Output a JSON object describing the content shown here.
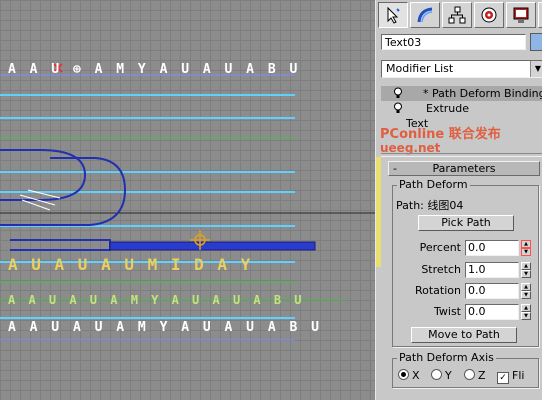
{
  "viewport": {
    "text_upper": "A A U ⊕ A M   Y A U A U A B U",
    "text_middle": "A U A U A U M I D A Y",
    "text_lower": "A A U A U A M   Y A U A U A B U",
    "text_bottom": "A A U A U A M   Y A U A U A B U"
  },
  "panel": {
    "tabs": [
      {
        "icon": "create-cursor-icon"
      },
      {
        "icon": "modify-arc-icon"
      },
      {
        "icon": "hierarchy-icon"
      },
      {
        "icon": "motion-icon"
      },
      {
        "icon": "display-icon"
      },
      {
        "icon": "utilities-hammer-icon"
      }
    ],
    "object_name": "Text03",
    "color_swatch": "#8fb4e6",
    "modifier_list_label": "Modifier List",
    "stack": [
      {
        "label": "* Path Deform Binding",
        "selected": true,
        "bulb": true
      },
      {
        "label": "Extrude",
        "selected": false,
        "bulb": true
      },
      {
        "label": "Text",
        "selected": false,
        "bulb": false
      }
    ],
    "watermark_main": "PConline 联合发布",
    "watermark_sub": "ueeg.net",
    "rollout": {
      "collapse_symbol": "-",
      "title": "Parameters",
      "path_deform_group": "Path Deform",
      "path_label": "Path: 线图04",
      "pick_path_button": "Pick Path",
      "spinners": [
        {
          "label": "Percent",
          "value": "0.0"
        },
        {
          "label": "Stretch",
          "value": "1.0"
        },
        {
          "label": "Rotation",
          "value": "0.0"
        },
        {
          "label": "Twist",
          "value": "0.0"
        }
      ],
      "move_to_path_button": "Move to Path",
      "axis_group": "Path Deform Axis",
      "axis_options": [
        "X",
        "Y",
        "Z"
      ],
      "axis_selected": "X",
      "flip_label": "Fli",
      "flip_checked": true
    }
  }
}
